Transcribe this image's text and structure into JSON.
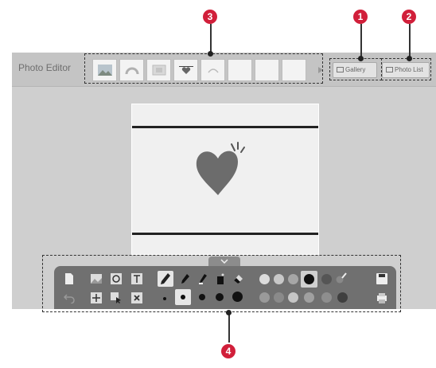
{
  "header": {
    "title": "Photo Editor",
    "gallery_label": "Gallery",
    "photo_list_label": "Photo List"
  },
  "callouts": [
    "3",
    "1",
    "2",
    "4"
  ],
  "colors": {
    "accent_red": "#d11f3a",
    "heart": "#6c6c6c",
    "toolbar": "#707070"
  }
}
